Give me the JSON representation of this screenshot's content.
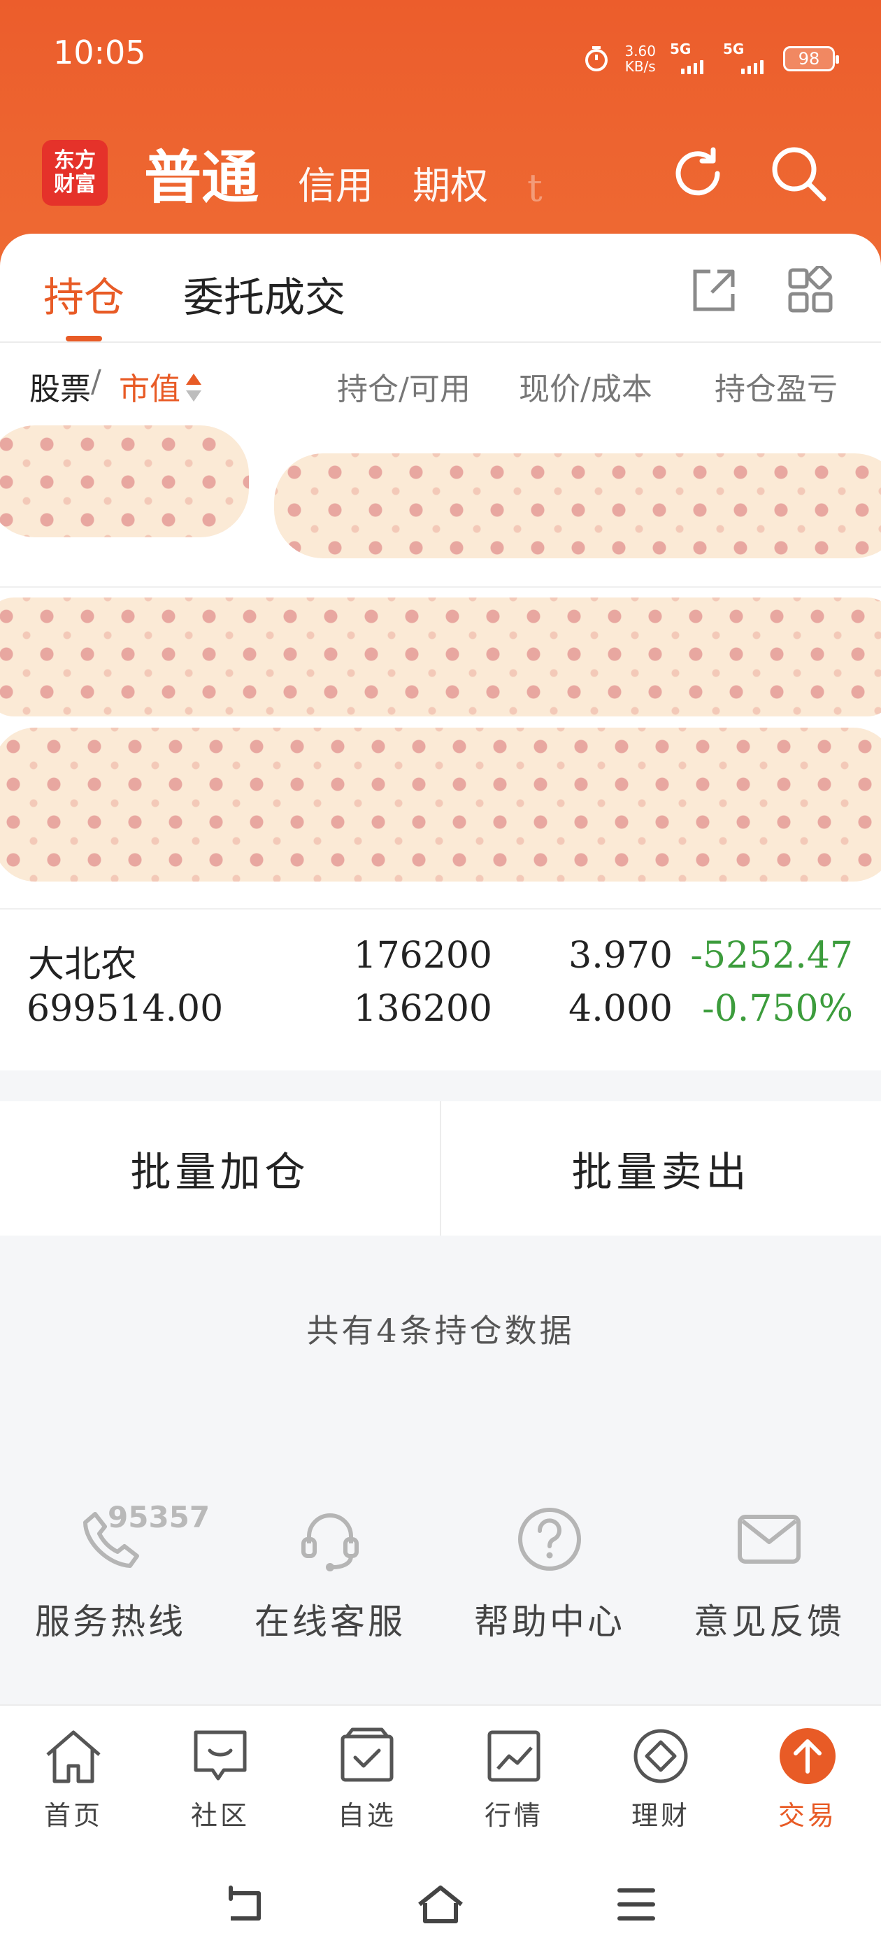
{
  "status_bar": {
    "time": "10:05",
    "net_speed_value": "3.60",
    "net_speed_unit": "KB/s",
    "sim1": "5G",
    "sim2": "5G",
    "battery": "98"
  },
  "header": {
    "logo_line1": "东方",
    "logo_line2": "财富",
    "account_tabs": [
      "普通",
      "信用",
      "期权",
      "t"
    ],
    "active_account_tab": "普通",
    "icons": [
      "refresh-icon",
      "search-icon"
    ]
  },
  "tabs": {
    "items": [
      "持仓",
      "委托成交"
    ],
    "active": "持仓"
  },
  "columns": {
    "stock": "股票",
    "sep1": "/",
    "market_value": "市值",
    "position_available": "持仓/可用",
    "price_cost": "现价/成本",
    "pnl": "持仓盈亏"
  },
  "position": {
    "name": "大北农",
    "market_value": "699514.00",
    "quantity": "176200",
    "available": "136200",
    "price": "3.970",
    "cost": "4.000",
    "pnl": "-5252.47",
    "pnl_pct": "-0.750%"
  },
  "colors": {
    "accent": "#e85b26",
    "loss_green": "#3c9c3c",
    "header_orange": "#ec5d2c"
  },
  "batch": {
    "add": "批量加仓",
    "sell": "批量卖出"
  },
  "summary": "共有4条持仓数据",
  "services": {
    "hotline_number": "95357",
    "items": [
      "服务热线",
      "在线客服",
      "帮助中心",
      "意见反馈"
    ]
  },
  "bottom_nav": {
    "items": [
      "首页",
      "社区",
      "自选",
      "行情",
      "理财",
      "交易"
    ],
    "active": "交易"
  }
}
